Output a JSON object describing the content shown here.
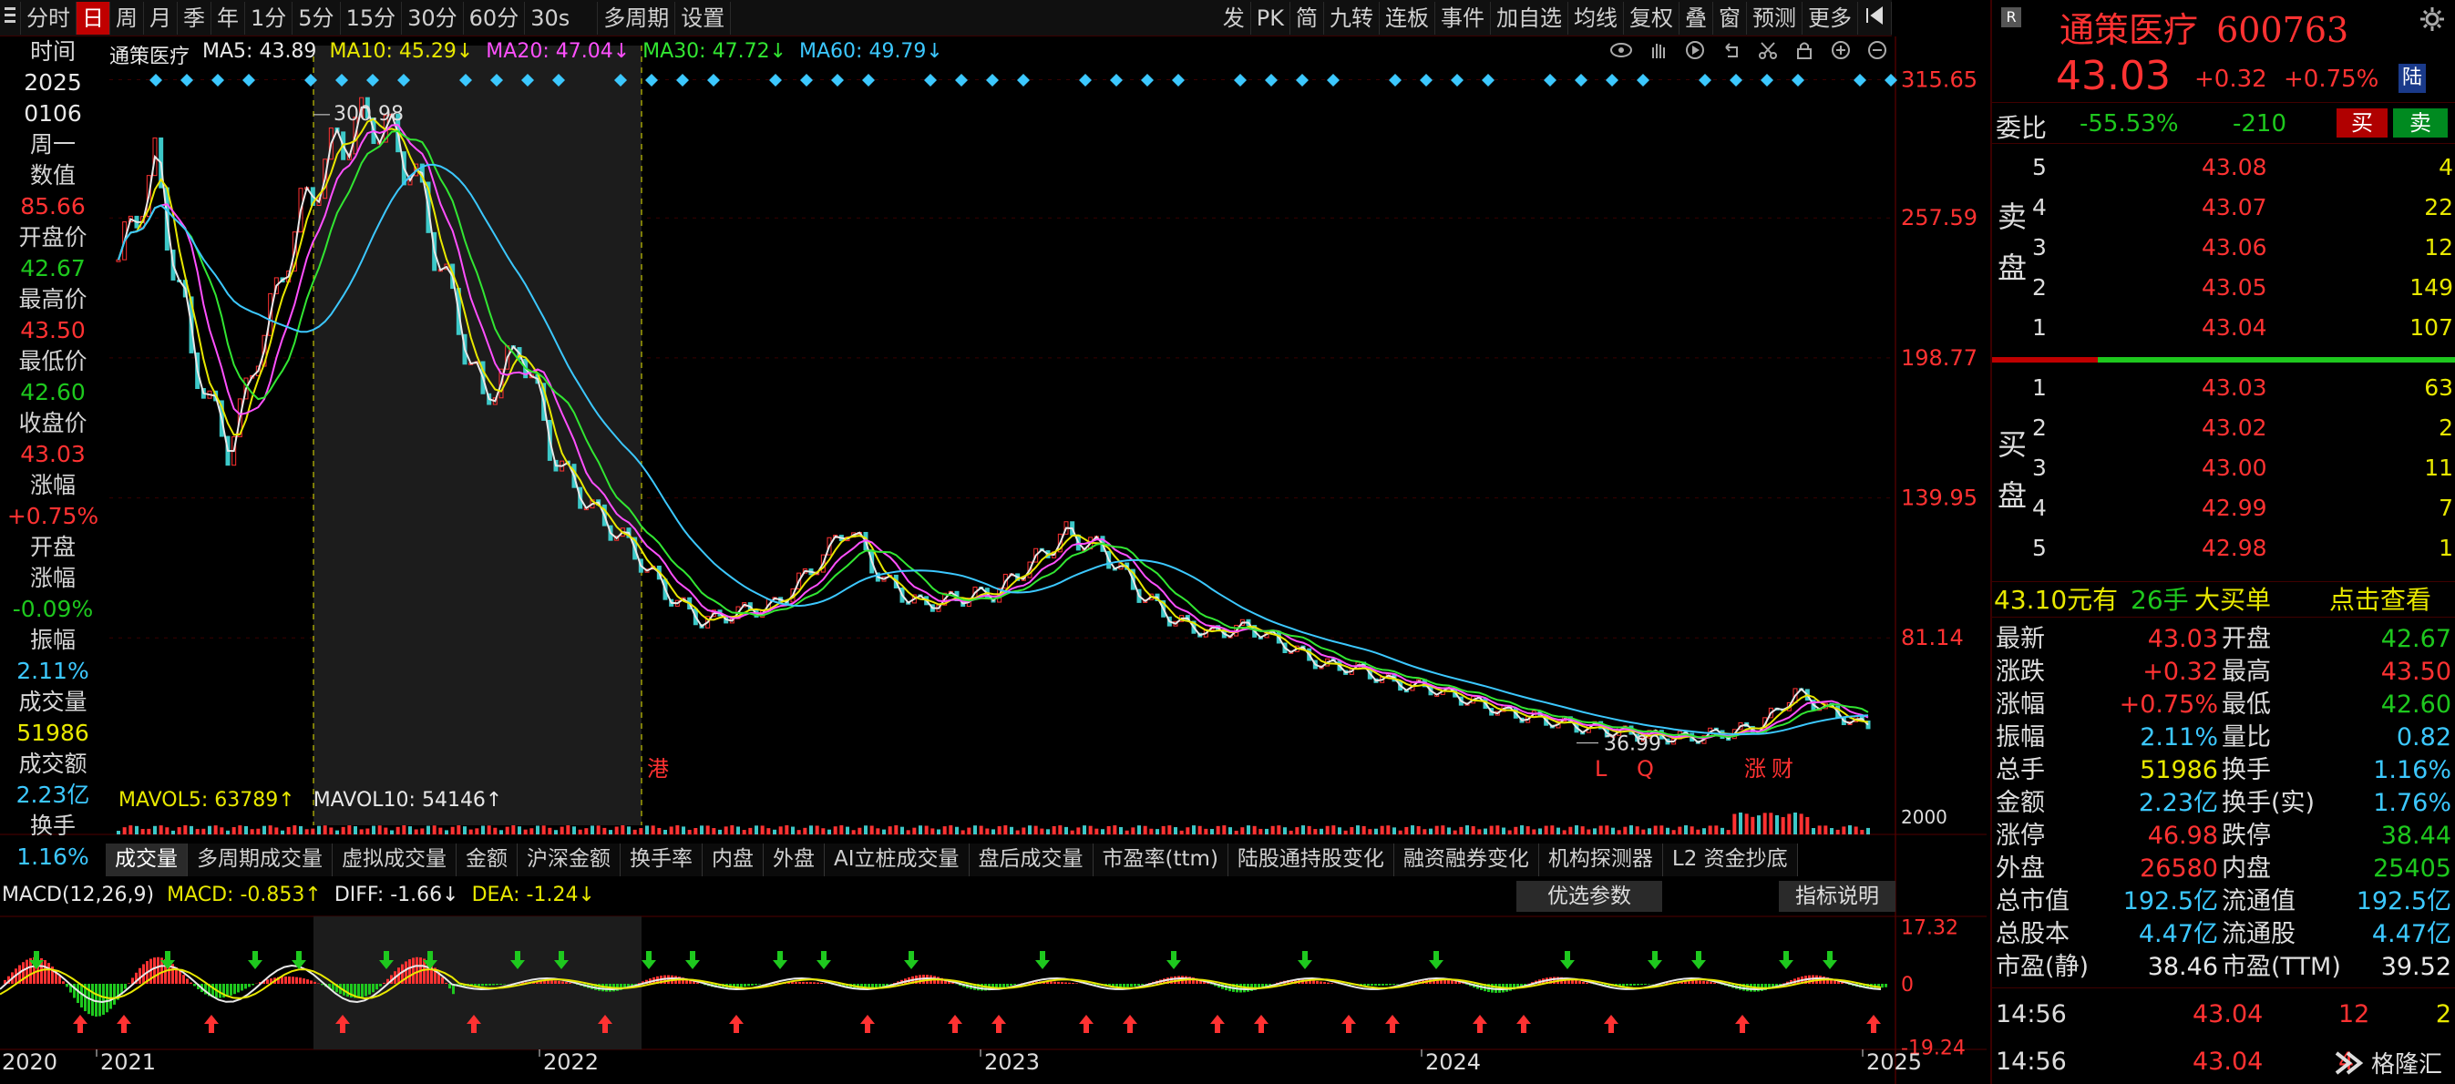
{
  "toolbar": {
    "left": [
      {
        "label": "分时"
      },
      {
        "label": "日",
        "active": true
      },
      {
        "label": "周"
      },
      {
        "label": "月"
      },
      {
        "label": "季"
      },
      {
        "label": "年"
      },
      {
        "label": "1分"
      },
      {
        "label": "5分"
      },
      {
        "label": "15分"
      },
      {
        "label": "30分"
      },
      {
        "label": "60分"
      },
      {
        "label": "30s"
      },
      {
        "label": "多周期"
      },
      {
        "label": "设置"
      }
    ],
    "right": [
      {
        "label": "发"
      },
      {
        "label": "PK"
      },
      {
        "label": "简"
      },
      {
        "label": "九转"
      },
      {
        "label": "连板"
      },
      {
        "label": "事件"
      },
      {
        "label": "加自选"
      },
      {
        "label": "均线"
      },
      {
        "label": "复权"
      },
      {
        "label": "叠"
      },
      {
        "label": "窗"
      },
      {
        "label": "预测"
      },
      {
        "label": "更多"
      }
    ]
  },
  "left_info": [
    {
      "text": "时间",
      "cls": "lbl"
    },
    {
      "text": "2025",
      "cls": "white"
    },
    {
      "text": "0106",
      "cls": "white"
    },
    {
      "text": "周一",
      "cls": "lbl"
    },
    {
      "text": "数值",
      "cls": "lbl"
    },
    {
      "text": "85.66",
      "cls": "red"
    },
    {
      "text": "开盘价",
      "cls": "lbl"
    },
    {
      "text": "42.67",
      "cls": "green"
    },
    {
      "text": "最高价",
      "cls": "lbl"
    },
    {
      "text": "43.50",
      "cls": "red"
    },
    {
      "text": "最低价",
      "cls": "lbl"
    },
    {
      "text": "42.60",
      "cls": "green"
    },
    {
      "text": "收盘价",
      "cls": "lbl"
    },
    {
      "text": "43.03",
      "cls": "red"
    },
    {
      "text": "涨幅",
      "cls": "lbl"
    },
    {
      "text": "+0.75%",
      "cls": "red"
    },
    {
      "text": "开盘",
      "cls": "lbl"
    },
    {
      "text": "涨幅",
      "cls": "lbl"
    },
    {
      "text": "-0.09%",
      "cls": "green"
    },
    {
      "text": "振幅",
      "cls": "lbl"
    },
    {
      "text": "2.11%",
      "cls": "cyan"
    },
    {
      "text": "成交量",
      "cls": "lbl"
    },
    {
      "text": "51986",
      "cls": "yellow"
    },
    {
      "text": "成交额",
      "cls": "lbl"
    },
    {
      "text": "2.23亿",
      "cls": "cyan"
    },
    {
      "text": "换手",
      "cls": "lbl"
    },
    {
      "text": "1.16%",
      "cls": "cyan"
    }
  ],
  "ma_legend": {
    "name": "通策医疗",
    "items": [
      {
        "text": "MA5: 43.89",
        "color": "#e8e8e8"
      },
      {
        "text": "MA10: 45.29↓",
        "color": "#e8e800"
      },
      {
        "text": "MA20: 47.04↓",
        "color": "#ff50ff"
      },
      {
        "text": "MA30: 47.72↓",
        "color": "#32e632"
      },
      {
        "text": "MA60: 49.79↓",
        "color": "#3cc8ff"
      }
    ]
  },
  "vol_legend": [
    {
      "text": "MAVOL5: 63789↑",
      "color": "#e8e800"
    },
    {
      "text": "MAVOL10: 54146↑",
      "color": "#e8e8e8"
    }
  ],
  "macd_legend": [
    {
      "text": "MACD(12,26,9)",
      "color": "#e8e8e8"
    },
    {
      "text": "MACD: -0.853↑",
      "color": "#e8e800"
    },
    {
      "text": "DIFF: -1.66↓",
      "color": "#e8e8e8"
    },
    {
      "text": "DEA: -1.24↓",
      "color": "#e8e800"
    }
  ],
  "indicator_tabs": [
    "成交量",
    "多周期成交量",
    "虚拟成交量",
    "金额",
    "沪深金额",
    "换手率",
    "内盘",
    "外盘",
    "AI立桩成交量",
    "盘后成交量",
    "市盈率(ttm)",
    "陆股通持股变化",
    "融资融券变化",
    "机构探测器",
    "L2 资金抄底"
  ],
  "buttons": {
    "optimize": "优选参数",
    "help": "指标说明"
  },
  "chart_data": [
    {
      "type": "line",
      "title": "通策医疗",
      "y_ticks": [
        315.65,
        257.59,
        198.77,
        139.95,
        81.14
      ],
      "x_ticks": [
        "2020",
        "2021",
        "2022",
        "2023",
        "2024",
        "2025"
      ],
      "annotations": [
        {
          "label": "300.98",
          "kind": "high"
        },
        {
          "label": "36.99",
          "kind": "low"
        },
        {
          "label": "港"
        },
        {
          "label": "L"
        },
        {
          "label": "Q"
        },
        {
          "label": "涨"
        },
        {
          "label": "财"
        }
      ],
      "series": [
        {
          "name": "MA5",
          "color": "#e8e8e8"
        },
        {
          "name": "MA10",
          "color": "#e8e800"
        },
        {
          "name": "MA20",
          "color": "#ff50ff"
        },
        {
          "name": "MA30",
          "color": "#32e632"
        },
        {
          "name": "MA60",
          "color": "#3cc8ff"
        }
      ],
      "x": [
        "2020-11",
        "2021-01",
        "2021-02",
        "2021-03",
        "2021-04",
        "2021-05",
        "2021-06",
        "2021-07",
        "2021-08",
        "2021-09",
        "2021-10",
        "2021-11",
        "2021-12",
        "2022-01",
        "2022-02",
        "2022-03",
        "2022-04",
        "2022-05",
        "2022-06",
        "2022-07",
        "2022-08",
        "2022-09",
        "2022-10",
        "2022-11",
        "2022-12",
        "2023-01",
        "2023-02",
        "2023-03",
        "2023-04",
        "2023-05",
        "2023-06",
        "2023-07",
        "2023-08",
        "2023-09",
        "2023-10",
        "2023-11",
        "2023-12",
        "2024-01",
        "2024-02",
        "2024-03",
        "2024-04",
        "2024-05",
        "2024-06",
        "2024-07",
        "2024-08",
        "2024-09",
        "2024-10",
        "2024-11",
        "2024-12"
      ],
      "close": [
        240,
        280,
        200,
        160,
        210,
        260,
        290,
        300,
        280,
        230,
        180,
        205,
        155,
        135,
        120,
        100,
        88,
        92,
        95,
        110,
        128,
        105,
        95,
        98,
        100,
        112,
        125,
        118,
        100,
        88,
        83,
        86,
        78,
        70,
        68,
        62,
        60,
        55,
        50,
        47,
        44,
        42,
        40,
        39,
        41,
        44,
        58,
        50,
        43
      ]
    },
    {
      "type": "bar",
      "title": "MACD",
      "y_ticks": [
        17.32,
        0,
        -19.24
      ]
    }
  ],
  "volume_axis_label": "2000",
  "right_panel": {
    "name": "通策医疗",
    "code": "600763",
    "price": "43.03",
    "change": "+0.32",
    "change_pct": "+0.75%",
    "tag": "陆",
    "weibi_label": "委比",
    "weibi_pct": "-55.53%",
    "weibi_diff": "-210",
    "buy_btn": "买",
    "sell_btn": "卖",
    "sell_side_label": [
      "卖",
      "盘"
    ],
    "buy_side_label": [
      "买",
      "盘"
    ],
    "asks": [
      {
        "lvl": "5",
        "price": "43.08",
        "vol": "4"
      },
      {
        "lvl": "4",
        "price": "43.07",
        "vol": "22"
      },
      {
        "lvl": "3",
        "price": "43.06",
        "vol": "12"
      },
      {
        "lvl": "2",
        "price": "43.05",
        "vol": "149"
      },
      {
        "lvl": "1",
        "price": "43.04",
        "vol": "107"
      }
    ],
    "bids": [
      {
        "lvl": "1",
        "price": "43.03",
        "vol": "63"
      },
      {
        "lvl": "2",
        "price": "43.02",
        "vol": "2"
      },
      {
        "lvl": "3",
        "price": "43.00",
        "vol": "11"
      },
      {
        "lvl": "4",
        "price": "42.99",
        "vol": "7"
      },
      {
        "lvl": "5",
        "price": "42.98",
        "vol": "1"
      }
    ],
    "big_order": {
      "price": "43.10元有",
      "qty": "26手",
      "label": "大买单",
      "link": "点击查看"
    },
    "stats": [
      [
        "最新",
        "43.03",
        "red",
        "开盘",
        "42.67",
        "green"
      ],
      [
        "涨跌",
        "+0.32",
        "red",
        "最高",
        "43.50",
        "red"
      ],
      [
        "涨幅",
        "+0.75%",
        "red",
        "最低",
        "42.60",
        "green"
      ],
      [
        "振幅",
        "2.11%",
        "cyan",
        "量比",
        "0.82",
        "cyan"
      ],
      [
        "总手",
        "51986",
        "yellow",
        "换手",
        "1.16%",
        "cyan"
      ],
      [
        "金额",
        "2.23亿",
        "cyan",
        "换手(实)",
        "1.76%",
        "cyan"
      ],
      [
        "涨停",
        "46.98",
        "red",
        "跌停",
        "38.44",
        "green"
      ],
      [
        "外盘",
        "26580",
        "red",
        "内盘",
        "25405",
        "green"
      ],
      [
        "总市值",
        "192.5亿",
        "cyan",
        "流通值",
        "192.5亿",
        "cyan"
      ],
      [
        "总股本",
        "4.47亿",
        "cyan",
        "流通股",
        "4.47亿",
        "cyan"
      ],
      [
        "市盈(静)",
        "38.46",
        "white",
        "市盈(TTM)",
        "39.52",
        "white"
      ]
    ],
    "ticks": [
      {
        "time": "14:56",
        "price": "43.04",
        "vol": "12",
        "extra": "2"
      },
      {
        "time": "14:56",
        "price": "43.04",
        "vol": "4",
        "extra": ""
      }
    ],
    "watermark": "格隆汇"
  }
}
